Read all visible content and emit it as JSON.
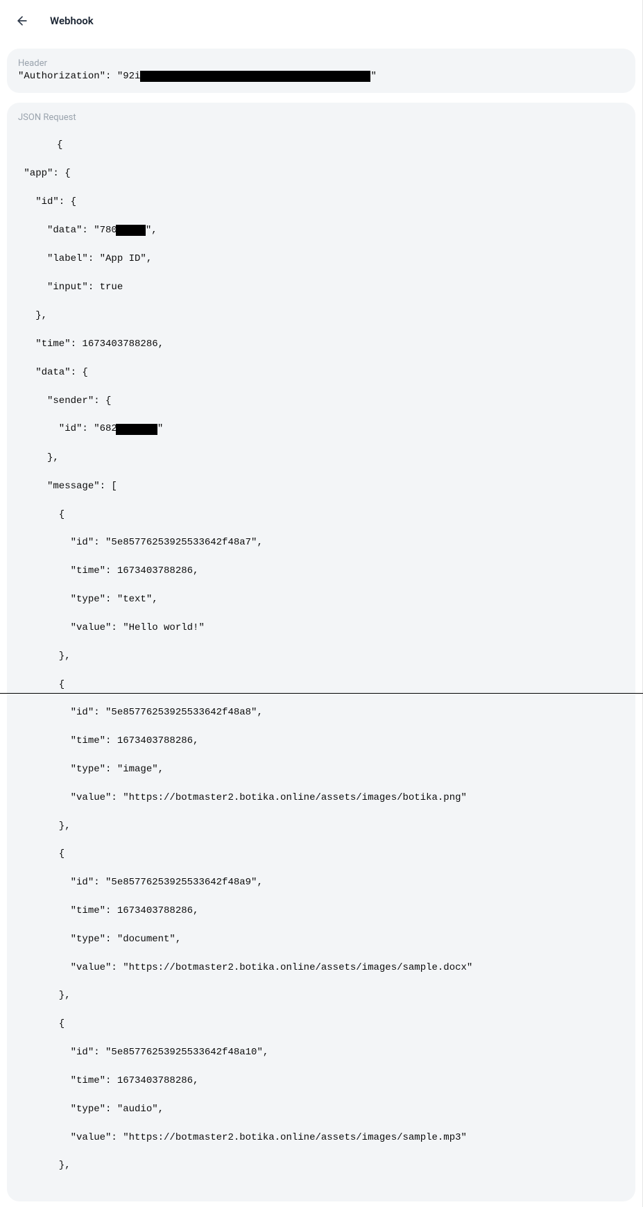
{
  "page_title": "Webhook",
  "sections": {
    "header": {
      "label": "Header",
      "key": "Authorization",
      "value_prefix": "92i",
      "value_redacted": true
    },
    "json_request": {
      "label": "JSON Request"
    }
  },
  "json_payload": {
    "app": {
      "id": {
        "data_prefix": "780",
        "data_redacted": true,
        "label": "App ID",
        "input": true
      },
      "time": 1673403788286,
      "data": {
        "sender": {
          "id_prefix": "682",
          "id_redacted": true
        },
        "message": [
          {
            "id": "5e85776253925533642f48a7",
            "time": 1673403788286,
            "type": "text",
            "value": "Hello world!"
          },
          {
            "id": "5e85776253925533642f48a8",
            "time": 1673403788286,
            "type": "image",
            "value": "https://botmaster2.botika.online/assets/images/botika.png"
          },
          {
            "id": "5e85776253925533642f48a9",
            "time": 1673403788286,
            "type": "document",
            "value": "https://botmaster2.botika.online/assets/images/sample.docx"
          },
          {
            "id": "5e85776253925533642f48a10",
            "time": 1673403788286,
            "type": "audio",
            "value": "https://botmaster2.botika.online/assets/images/sample.mp3"
          }
        ]
      }
    }
  },
  "text": {
    "opening_brace": "{",
    "app_open": " \"app\": {",
    "id_open": "   \"id\": {",
    "data_prefix": "     \"data\": \"780",
    "data_suffix": "\",",
    "label_line": "     \"label\": \"App ID\",",
    "input_line": "     \"input\": true",
    "id_close": "   },",
    "time_line": "   \"time\": 1673403788286,",
    "data_open": "   \"data\": {",
    "sender_open": "     \"sender\": {",
    "sender_id_prefix": "       \"id\": \"682",
    "sender_id_suffix": "\"",
    "sender_close": "     },",
    "message_open": "     \"message\": [",
    "msg_obj_open": "       {",
    "m1_id": "         \"id\": \"5e85776253925533642f48a7\",",
    "m1_time": "         \"time\": 1673403788286,",
    "m1_type": "         \"type\": \"text\",",
    "m1_value": "         \"value\": \"Hello world!\"",
    "msg_obj_close": "       },",
    "m2_id": "         \"id\": \"5e85776253925533642f48a8\",",
    "m2_time": "         \"time\": 1673403788286,",
    "m2_type": "         \"type\": \"image\",",
    "m2_value": "         \"value\": \"https://botmaster2.botika.online/assets/images/botika.png\"",
    "m3_id": "         \"id\": \"5e85776253925533642f48a9\",",
    "m3_time": "         \"time\": 1673403788286,",
    "m3_type": "         \"type\": \"document\",",
    "m3_value": "         \"value\": \"https://botmaster2.botika.online/assets/images/sample.docx\"",
    "m4_id": "         \"id\": \"5e85776253925533642f48a10\",",
    "m4_time": "         \"time\": 1673403788286,",
    "m4_type": "         \"type\": \"audio\",",
    "m4_value": "         \"value\": \"https://botmaster2.botika.online/assets/images/sample.mp3\"",
    "auth_prefix": "\"Authorization\": \"92i",
    "auth_suffix": "\""
  }
}
